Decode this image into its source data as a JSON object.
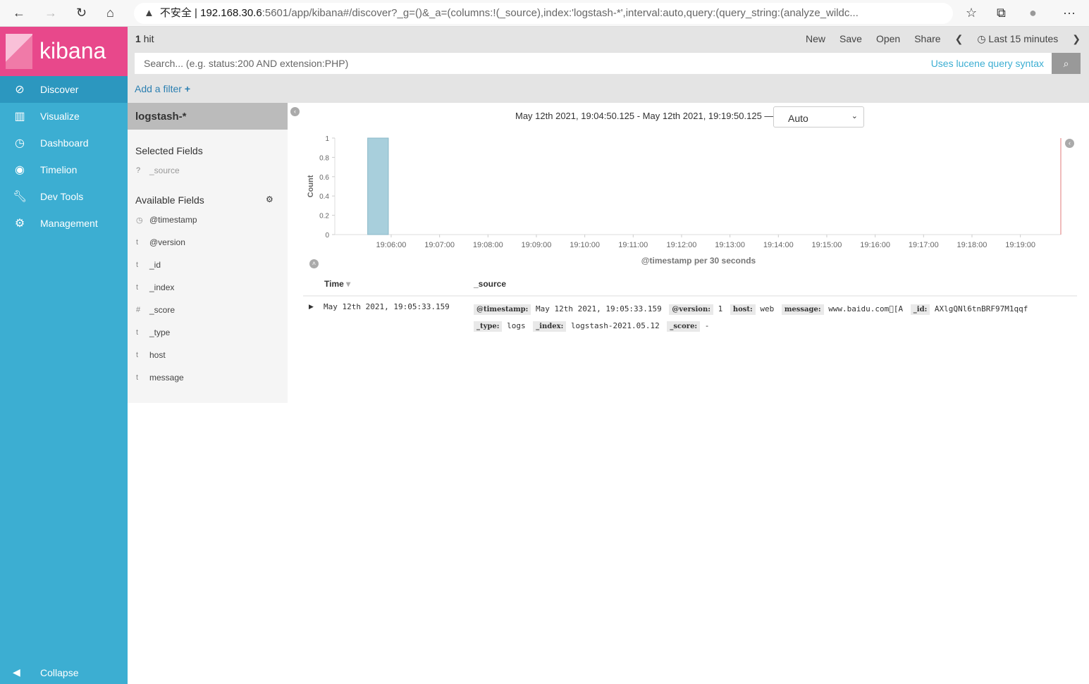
{
  "browser": {
    "security": "不安全",
    "url_host": "192.168.30.6",
    "url_path": ":5601/app/kibana#/discover?_g=()&_a=(columns:!(_source),index:'logstash-*',interval:auto,query:(query_string:(analyze_wildc..."
  },
  "sidebar": {
    "logo": "kibana",
    "items": [
      {
        "label": "Discover",
        "icon": "compass-icon"
      },
      {
        "label": "Visualize",
        "icon": "bar-chart-icon"
      },
      {
        "label": "Dashboard",
        "icon": "gauge-icon"
      },
      {
        "label": "Timelion",
        "icon": "mask-icon"
      },
      {
        "label": "Dev Tools",
        "icon": "wrench-icon"
      },
      {
        "label": "Management",
        "icon": "gear-icon"
      }
    ],
    "collapse": "Collapse"
  },
  "topbar": {
    "hits_count": "1",
    "hits_label": "hit",
    "new": "New",
    "save": "Save",
    "open": "Open",
    "share": "Share",
    "time": "Last 15 minutes",
    "search_placeholder": "Search... (e.g. status:200 AND extension:PHP)",
    "lucene": "Uses lucene query syntax",
    "add_filter": "Add a filter"
  },
  "fields": {
    "index": "logstash-*",
    "selected_title": "Selected Fields",
    "selected": [
      {
        "type": "?",
        "name": "_source"
      }
    ],
    "available_title": "Available Fields",
    "available": [
      {
        "type": "◷",
        "name": "@timestamp"
      },
      {
        "type": "t",
        "name": "@version"
      },
      {
        "type": "t",
        "name": "_id"
      },
      {
        "type": "t",
        "name": "_index"
      },
      {
        "type": "#",
        "name": "_score"
      },
      {
        "type": "t",
        "name": "_type"
      },
      {
        "type": "t",
        "name": "host"
      },
      {
        "type": "t",
        "name": "message"
      }
    ]
  },
  "histogram": {
    "range": "May 12th 2021, 19:04:50.125 - May 12th 2021, 19:19:50.125 —",
    "interval": "Auto"
  },
  "chart_data": {
    "type": "bar",
    "xlabel": "@timestamp per 30 seconds",
    "ylabel": "Count",
    "xlim": [
      "19:04:50.125",
      "19:19:50.125"
    ],
    "ylim": [
      0,
      1
    ],
    "x_ticks": [
      "19:06:00",
      "19:07:00",
      "19:08:00",
      "19:09:00",
      "19:10:00",
      "19:11:00",
      "19:12:00",
      "19:13:00",
      "19:14:00",
      "19:15:00",
      "19:16:00",
      "19:17:00",
      "19:18:00",
      "19:19:00"
    ],
    "y_ticks": [
      "0",
      "0.2",
      "0.4",
      "0.6",
      "0.8",
      "1"
    ],
    "bars": [
      {
        "x": "19:05:30",
        "value": 1
      }
    ],
    "color": "#a8cfdc"
  },
  "table": {
    "col_time": "Time",
    "col_source": "_source",
    "rows": [
      {
        "time": "May 12th 2021, 19:05:33.159",
        "fields": [
          {
            "k": "@timestamp:",
            "v": "May 12th 2021, 19:05:33.159"
          },
          {
            "k": "@version:",
            "v": "1"
          },
          {
            "k": "host:",
            "v": "web"
          },
          {
            "k": "message:",
            "v": "www.baidu.com\u0000[A"
          },
          {
            "k": "_id:",
            "v": "AXlgQNl6tnBRF97M1qqf"
          },
          {
            "k": "_type:",
            "v": "logs"
          },
          {
            "k": "_index:",
            "v": "logstash-2021.05.12"
          },
          {
            "k": "_score:",
            "v": "-"
          }
        ]
      }
    ]
  }
}
